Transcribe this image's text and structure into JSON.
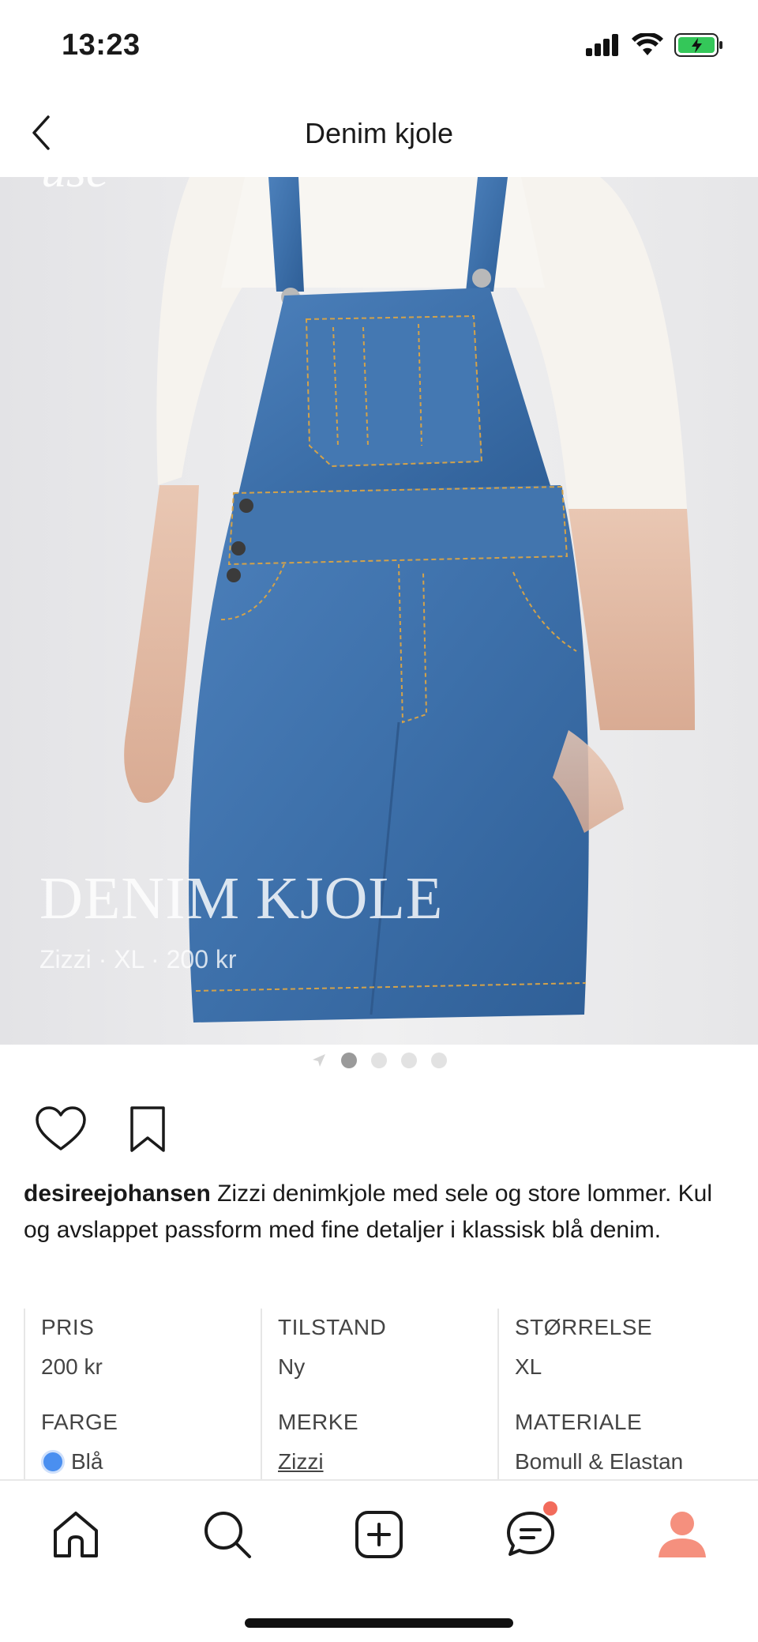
{
  "status_bar": {
    "time": "13:23",
    "icons": [
      "signal-icon",
      "wifi-icon",
      "battery-charging-icon"
    ]
  },
  "nav": {
    "title": "Denim kjole",
    "back_icon": "chevron-left-icon"
  },
  "hero": {
    "title": "DENIM KJOLE",
    "subtitle": "Zizzi · XL · 200 kr"
  },
  "pager": {
    "total": 4,
    "active_index": 0,
    "leading_icon": "location-arrow-icon"
  },
  "actions": {
    "like_icon": "heart-icon",
    "save_icon": "bookmark-icon"
  },
  "post": {
    "username": "desireejohansen",
    "text": " Zizzi denimkjole med sele og store lommer. Kul og avslappet passform med fine detaljer i klassisk blå denim."
  },
  "attributes": [
    {
      "label": "PRIS",
      "value": "200 kr"
    },
    {
      "label": "TILSTAND",
      "value": "Ny"
    },
    {
      "label": "STØRRELSE",
      "value": "XL"
    },
    {
      "label": "FARGE",
      "value": "Blå",
      "swatch_color": "#4a8ff0"
    },
    {
      "label": "MERKE",
      "value": "Zizzi"
    },
    {
      "label": "MATERIALE",
      "value": "Bomull & Elastan"
    }
  ],
  "tab_bar": {
    "tabs": [
      "home-icon",
      "search-icon",
      "add-icon",
      "messages-icon",
      "profile-icon"
    ],
    "badge_color": "#f26b5b",
    "profile_color": "#f5907e"
  },
  "colors": {
    "accent": "#f26b5b",
    "denim": "#3f74ad",
    "text": "#1a1a1a"
  }
}
